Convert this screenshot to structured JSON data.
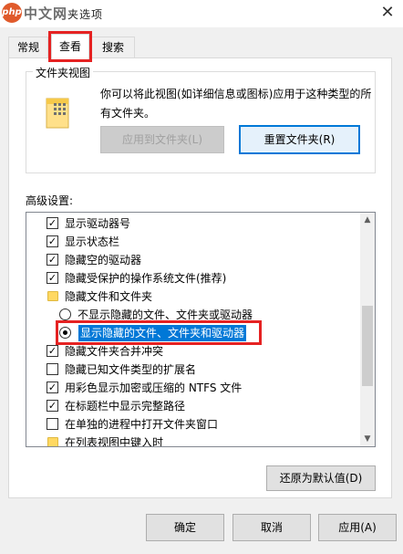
{
  "watermark": {
    "logo": "php",
    "text": "中文网"
  },
  "window": {
    "title_fragment": "夹选项",
    "close_glyph": "✕"
  },
  "tabs": [
    {
      "label": "常规"
    },
    {
      "label": "查看"
    },
    {
      "label": "搜索"
    }
  ],
  "folder_views": {
    "title": "文件夹视图",
    "description": "你可以将此视图(如详细信息或图标)应用于这种类型的所有文件夹。",
    "apply_button": "应用到文件夹(L)",
    "reset_button": "重置文件夹(R)"
  },
  "advanced": {
    "label": "高级设置:",
    "items": [
      {
        "type": "checkbox",
        "checked": true,
        "label": "显示驱动器号"
      },
      {
        "type": "checkbox",
        "checked": true,
        "label": "显示状态栏"
      },
      {
        "type": "checkbox",
        "checked": true,
        "label": "隐藏空的驱动器"
      },
      {
        "type": "checkbox",
        "checked": true,
        "label": "隐藏受保护的操作系统文件(推荐)"
      },
      {
        "type": "folder",
        "label": "隐藏文件和文件夹"
      },
      {
        "type": "radio",
        "checked": false,
        "label": "不显示隐藏的文件、文件夹或驱动器"
      },
      {
        "type": "radio",
        "checked": true,
        "label": "显示隐藏的文件、文件夹和驱动器"
      },
      {
        "type": "checkbox",
        "checked": true,
        "label": "隐藏文件夹合并冲突"
      },
      {
        "type": "checkbox",
        "checked": false,
        "label": "隐藏已知文件类型的扩展名"
      },
      {
        "type": "checkbox",
        "checked": true,
        "label": "用彩色显示加密或压缩的 NTFS 文件"
      },
      {
        "type": "checkbox",
        "checked": true,
        "label": "在标题栏中显示完整路径"
      },
      {
        "type": "checkbox",
        "checked": false,
        "label": "在单独的进程中打开文件夹窗口"
      },
      {
        "type": "folder",
        "label": "在列表视图中键入时"
      }
    ],
    "restore_button": "还原为默认值(D)"
  },
  "footer": {
    "ok": "确定",
    "cancel": "取消",
    "apply": "应用(A)"
  },
  "colors": {
    "accent": "#0078d7",
    "highlight_box": "#e52222",
    "dialog_bg": "#f0f0f0"
  }
}
